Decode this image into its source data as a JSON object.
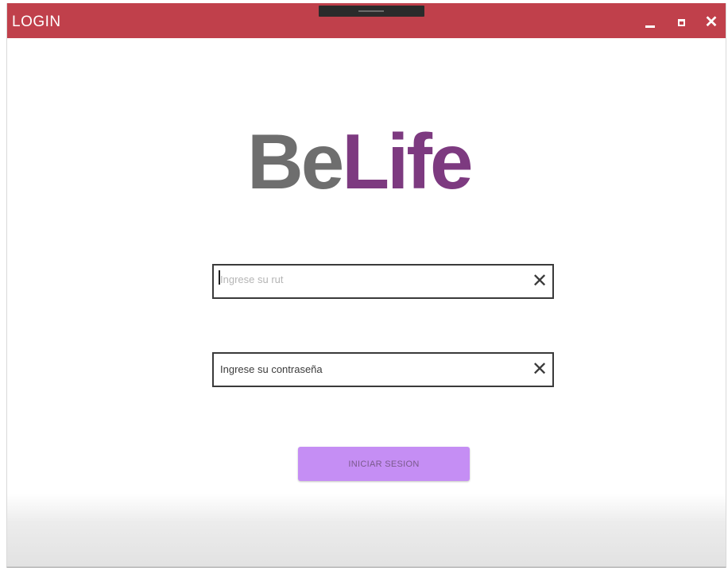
{
  "window": {
    "title": "LOGIN"
  },
  "controls": {
    "minimize_icon": "minimize-icon",
    "maximize_icon": "maximize-icon",
    "close_icon": "close-icon",
    "close_glyph": "✕"
  },
  "logo": {
    "part1": "Be",
    "part2": "Life",
    "color_part1": "#6e6e6e",
    "color_part2": "#7d3a80"
  },
  "form": {
    "rut_placeholder": "Ingrese su rut",
    "password_placeholder": "Ingrese su contraseña",
    "clear_glyph": "✕",
    "submit_label": "INICIAR SESION"
  },
  "colors": {
    "titlebar": "#c0404b",
    "button": "#c58ef4"
  }
}
